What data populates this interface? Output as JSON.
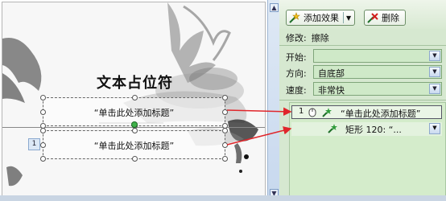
{
  "slide": {
    "placeholder_title": "文本占位符",
    "textbox1_text": "“单击此处添加标题”",
    "textbox2_text": "“单击此处添加标题”",
    "sequence_tag": "1"
  },
  "panel": {
    "add_effect_label": "添加效果",
    "delete_label": "删除",
    "modify_label": "修改:",
    "modify_value": "擦除",
    "start_label": "开始:",
    "start_value": "",
    "direction_label": "方向:",
    "direction_value": "自底部",
    "speed_label": "速度:",
    "speed_value": "非常快",
    "list": [
      {
        "number": "1",
        "text": "“单击此处添加标题”"
      },
      {
        "number": "",
        "text": "矩形 120: “..."
      }
    ]
  },
  "colors": {
    "panel_bg": "#d6e8d0",
    "combo_bg": "#cfe9c8",
    "arrow_red": "#e0262b",
    "effect_star": "#2f9b3a"
  }
}
